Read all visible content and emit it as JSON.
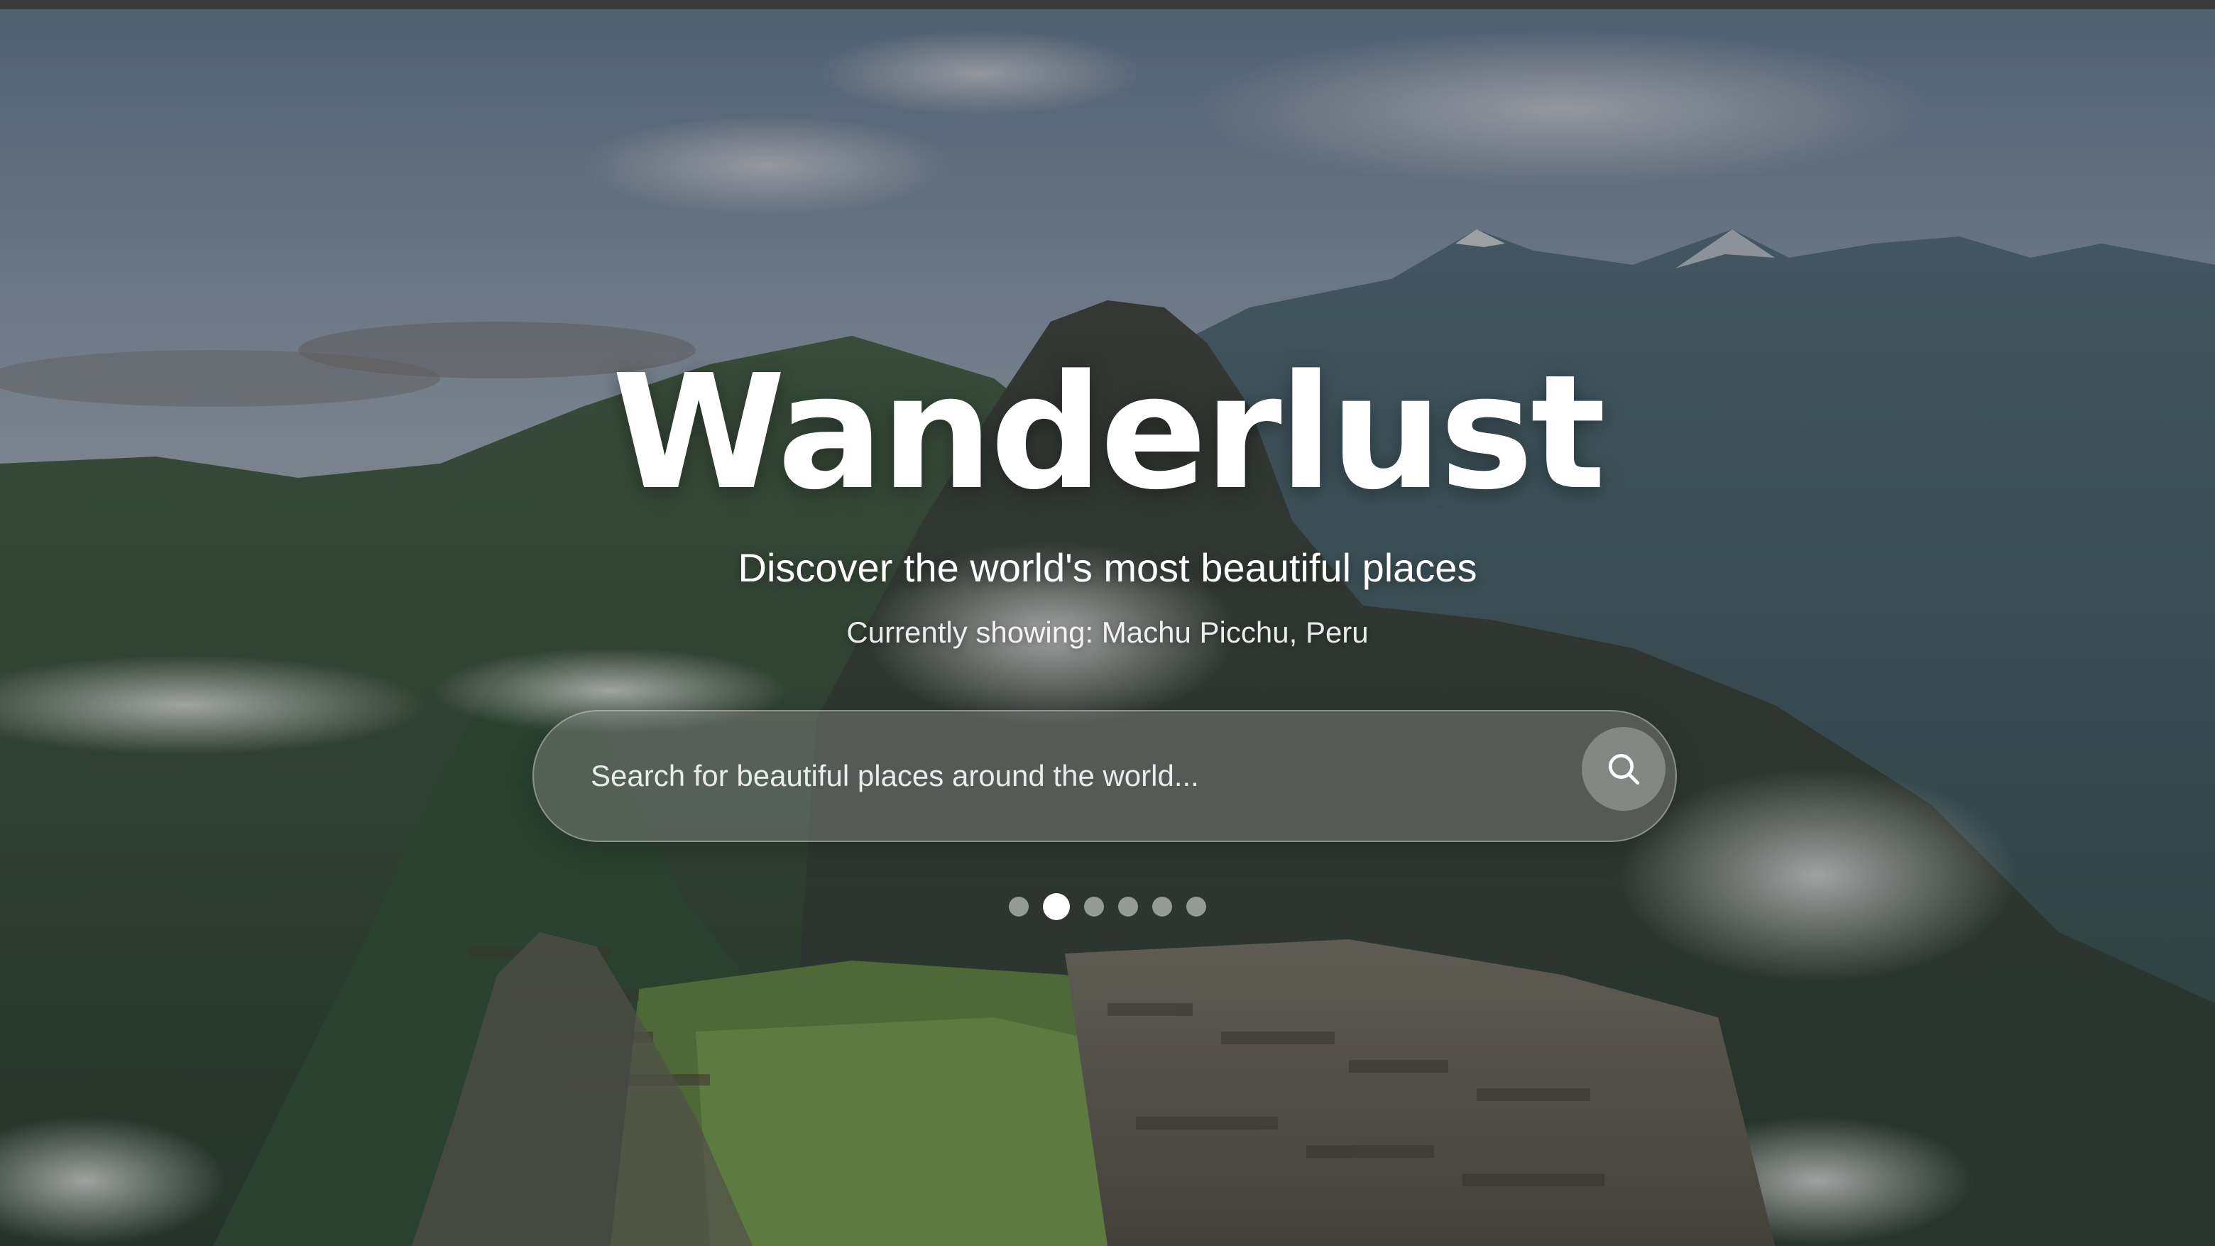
{
  "hero": {
    "title": "Wanderlust",
    "subtitle": "Discover the world's most beautiful places",
    "status_text": "Currently showing: Machu Picchu, Peru"
  },
  "search": {
    "placeholder": "Search for beautiful places around the world...",
    "value": "",
    "button_icon": "search-icon"
  },
  "carousel": {
    "total_slides": 6,
    "active_index": 1
  },
  "colors": {
    "text": "#ffffff",
    "sky": "#8493a3",
    "mountain": "#3b5147",
    "grass": "#6a8a45"
  }
}
